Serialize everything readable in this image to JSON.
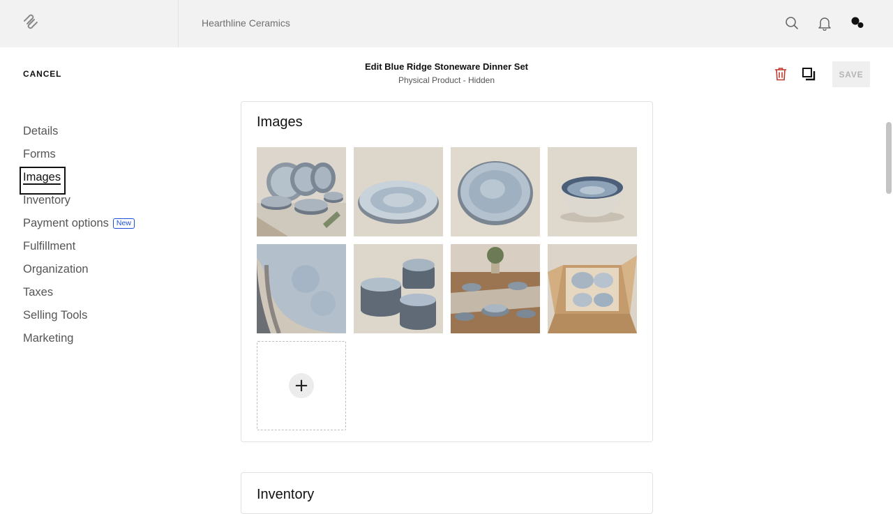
{
  "topbar": {
    "site_name": "Hearthline Ceramics",
    "icons": [
      "squarespace-logo-icon",
      "search-icon",
      "bell-icon",
      "account-icon"
    ]
  },
  "header": {
    "cancel_label": "CANCEL",
    "title": "Edit Blue Ridge Stoneware Dinner Set",
    "subtitle": "Physical Product - Hidden",
    "save_label": "SAVE",
    "icons": [
      "trash-icon",
      "duplicate-icon"
    ],
    "colors": {
      "trash": "#c0392b",
      "save_text": "#b4b4b4"
    }
  },
  "nav": {
    "items": [
      {
        "label": "Details"
      },
      {
        "label": "Forms"
      },
      {
        "label": "Images",
        "active": true
      },
      {
        "label": "Inventory"
      },
      {
        "label": "Payment options",
        "badge": "New"
      },
      {
        "label": "Fulfillment"
      },
      {
        "label": "Organization"
      },
      {
        "label": "Taxes"
      },
      {
        "label": "Selling Tools"
      },
      {
        "label": "Marketing"
      }
    ]
  },
  "images_card": {
    "title": "Images",
    "image_count": 8,
    "add_label": "+"
  },
  "inventory_card": {
    "title": "Inventory"
  }
}
